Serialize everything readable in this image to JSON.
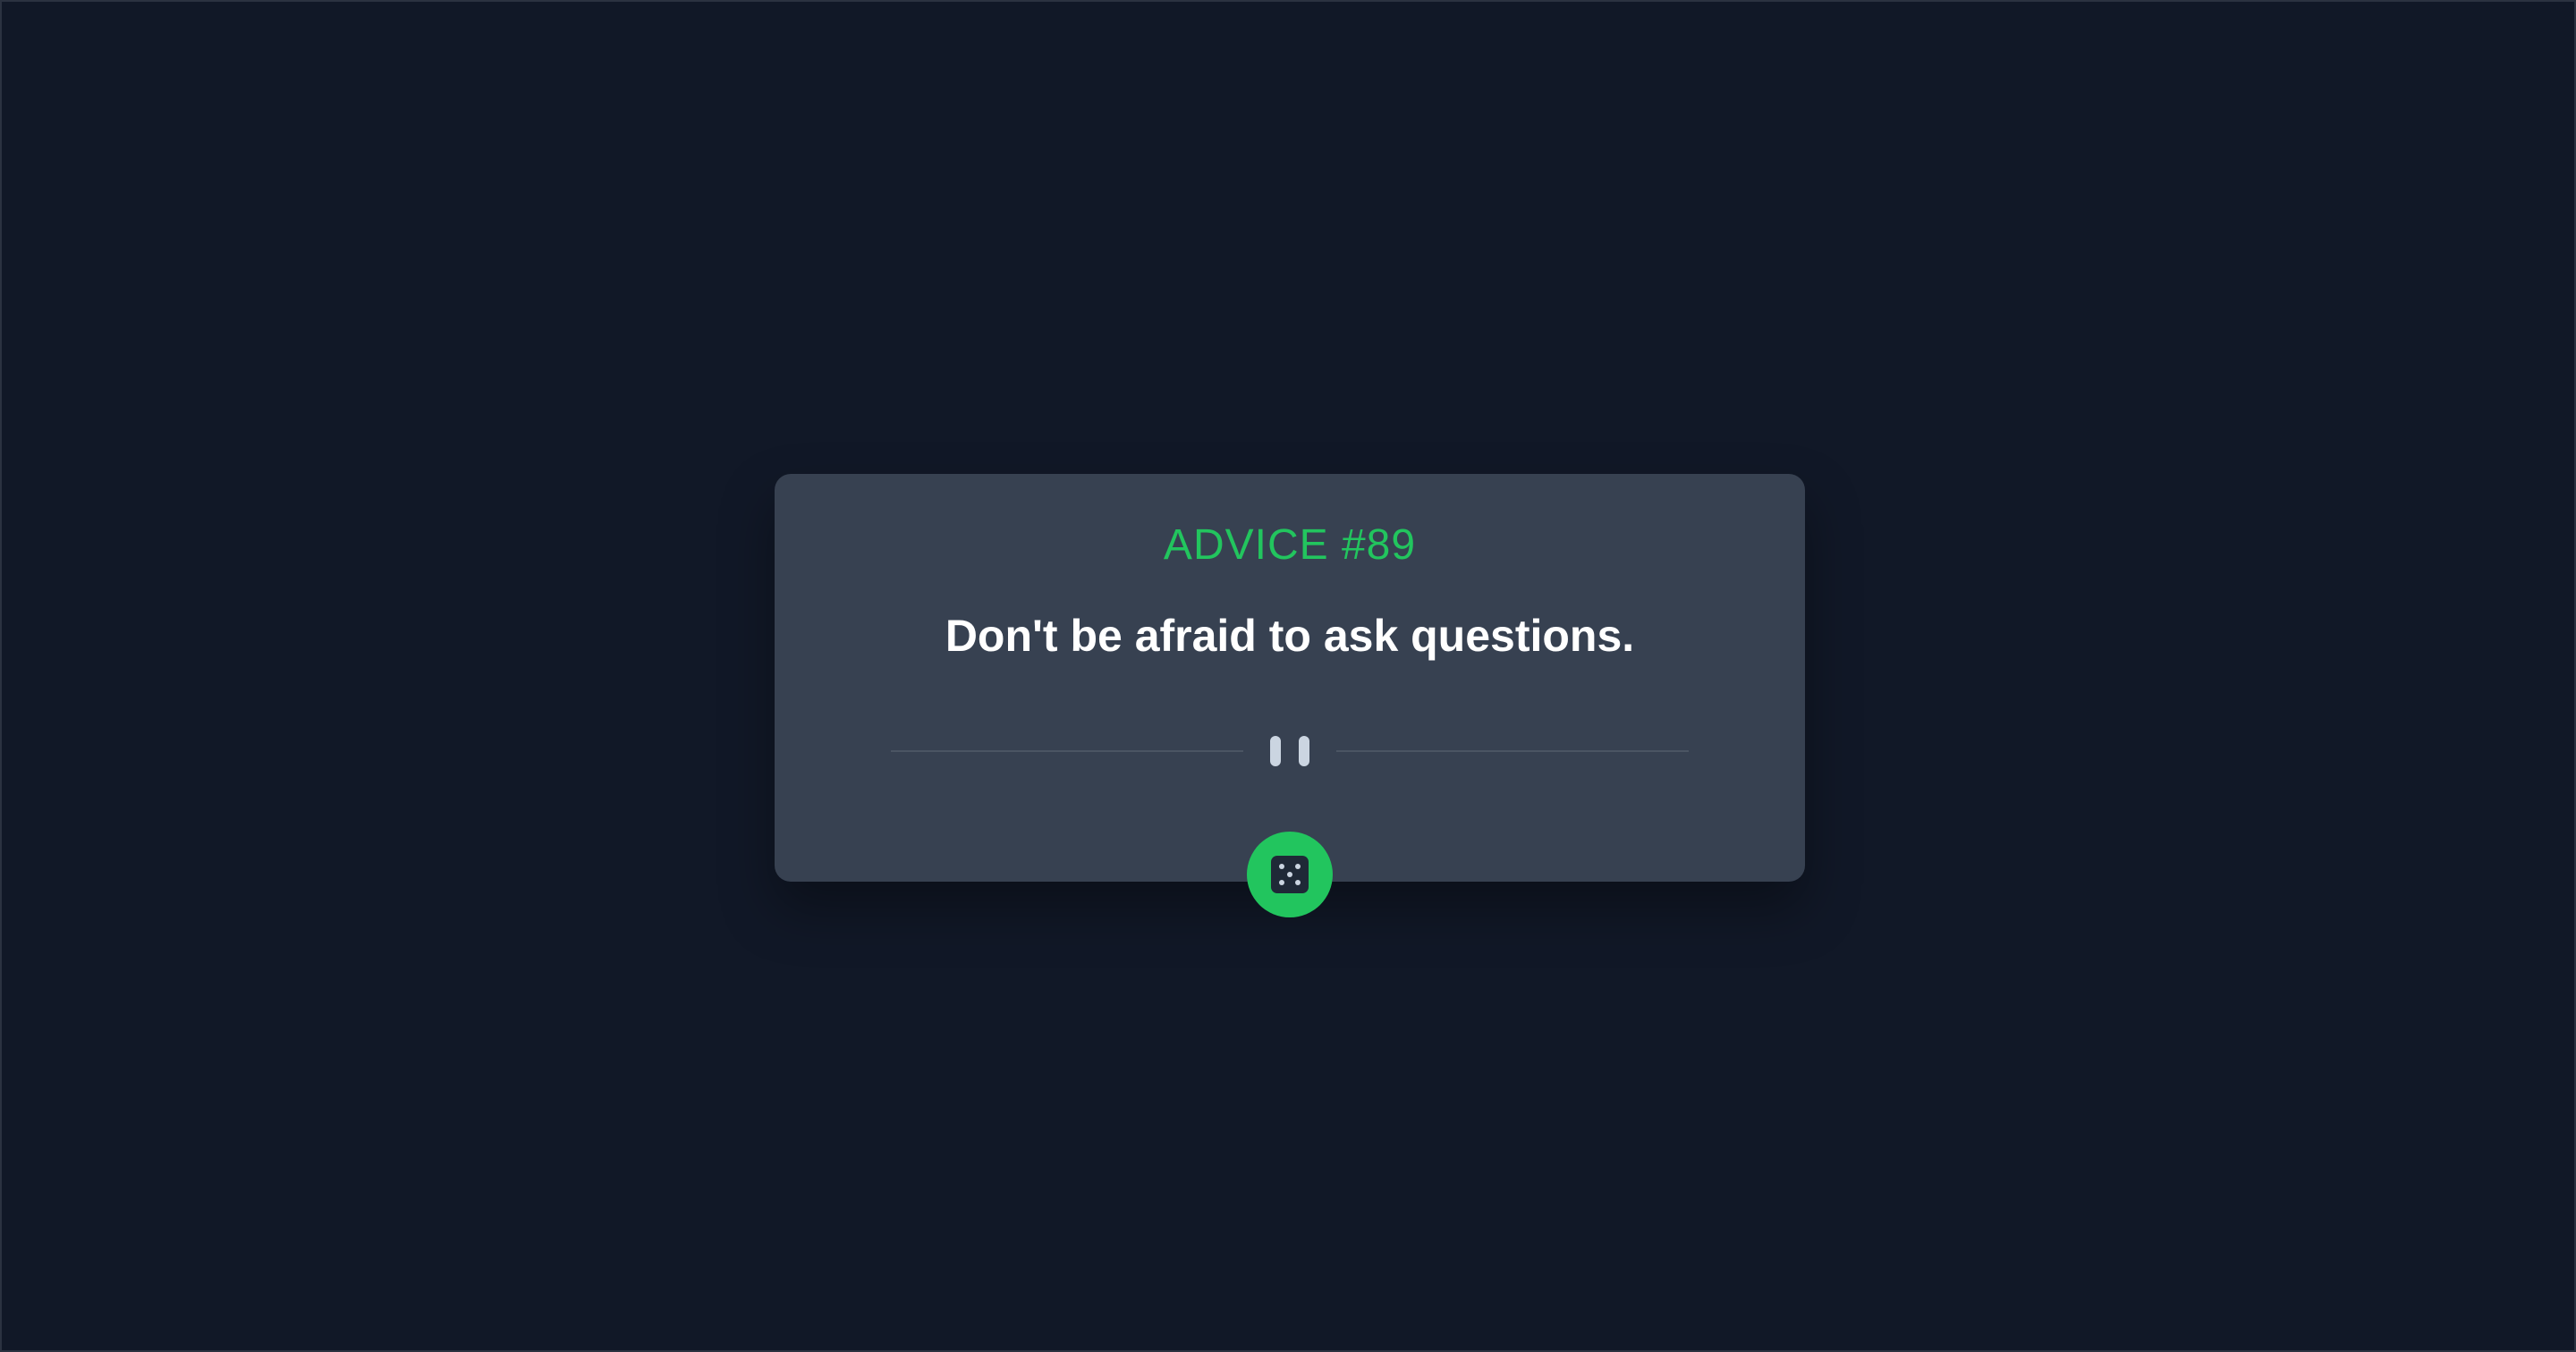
{
  "card": {
    "advice_id_label": "ADVICE #89",
    "advice_text": "Don't be afraid to ask questions."
  },
  "divider": {
    "icon": "pause-icon"
  },
  "dice_button": {
    "icon": "dice-icon"
  },
  "colors": {
    "background": "#111827",
    "card": "#374151",
    "accent": "#22c55e",
    "text": "#ffffff",
    "divider": "#4b5563",
    "pause": "#cbd5e1"
  }
}
